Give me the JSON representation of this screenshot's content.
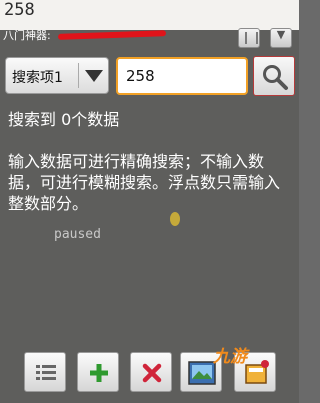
{
  "background": {
    "handwritten_number": "258",
    "paused_label": "paused"
  },
  "titlebar": {
    "title": "八门神器: ",
    "menu_icon": "menu-icon",
    "collapse_icon": "collapse-icon"
  },
  "search": {
    "field_select_label": "搜索项1",
    "value": "258",
    "search_icon": "magnifier-icon"
  },
  "results": {
    "count_text": "搜索到 0个数据",
    "hint": "输入数据可进行精确搜索；不输入数据，可进行模糊搜索。浮点数只需输入整数部分。"
  },
  "toolbar": {
    "buttons": [
      {
        "name": "list-button",
        "icon": "list-icon"
      },
      {
        "name": "add-button",
        "icon": "plus-icon",
        "color": "#2f9a2f"
      },
      {
        "name": "delete-button",
        "icon": "x-icon",
        "color": "#d0253a"
      },
      {
        "name": "photo-button",
        "icon": "picture-icon"
      },
      {
        "name": "pin-button",
        "icon": "pin-icon"
      }
    ]
  },
  "watermark": {
    "text": "九游"
  },
  "colors": {
    "input_border": "#f2a126",
    "search_border": "#b53a3a",
    "overlay": "#3a3a3a"
  }
}
